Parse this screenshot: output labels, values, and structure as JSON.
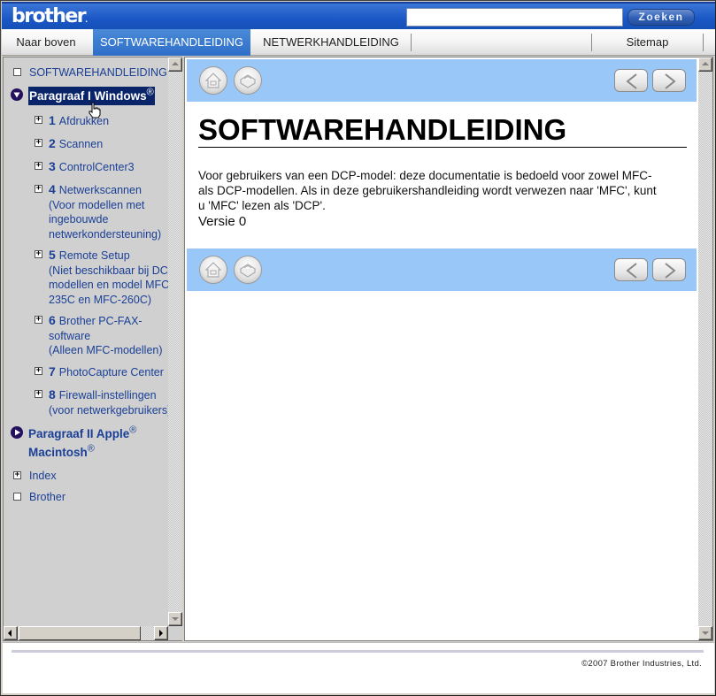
{
  "header": {
    "logo": "brother",
    "search": {
      "value": "",
      "placeholder": ""
    },
    "search_button": "Zoeken"
  },
  "nav": {
    "tabs": [
      {
        "label": "Naar boven",
        "active": false
      },
      {
        "label": "SOFTWAREHANDLEIDING",
        "active": true
      },
      {
        "label": "NETWERKHANDLEIDING",
        "active": false
      },
      {
        "label": "Sitemap",
        "active": false
      }
    ]
  },
  "sidebar": {
    "root": {
      "label": "SOFTWAREHANDLEIDING",
      "icon": "page-icon"
    },
    "section1": {
      "label": "Paragraaf I Windows",
      "sup": "®",
      "state": "expanded",
      "selected": true
    },
    "items": [
      {
        "num": "1",
        "lines": [
          "Afdrukken"
        ]
      },
      {
        "num": "2",
        "lines": [
          "Scannen"
        ]
      },
      {
        "num": "3",
        "lines": [
          "ControlCenter3"
        ]
      },
      {
        "num": "4",
        "lines": [
          "Netwerkscannen",
          "(Voor modellen met",
          "ingebouwde",
          "netwerkondersteuning)"
        ]
      },
      {
        "num": "5",
        "lines": [
          "Remote Setup",
          "(Niet beschikbaar bij DCP-",
          "modellen en model MFC-",
          "235C en MFC-260C)"
        ]
      },
      {
        "num": "6",
        "lines": [
          "Brother PC-FAX-",
          "software",
          "(Alleen MFC-modellen)"
        ]
      },
      {
        "num": "7",
        "lines": [
          "PhotoCapture Center"
        ]
      },
      {
        "num": "8",
        "lines": [
          "Firewall-instellingen",
          "(voor netwerkgebruikers)"
        ]
      }
    ],
    "section2": {
      "line1": "Paragraaf II Apple",
      "line2": "Macintosh",
      "sup": "®",
      "state": "collapsed"
    },
    "index": {
      "label": "Index",
      "icon": "plus-icon"
    },
    "brother": {
      "label": "Brother",
      "icon": "page-icon"
    }
  },
  "main": {
    "title": "SOFTWAREHANDLEIDING",
    "intro": "Voor gebruikers van een DCP-model: deze documentatie is bedoeld voor zowel MFC-als DCP-modellen. Als in deze gebruikershandleiding wordt verwezen naar 'MFC', kunt u 'MFC' lezen als 'DCP'.",
    "intro_lines": [
      "Voor gebruikers van een DCP-model: deze documentatie is bedoeld voor zowel MFC-",
      "als DCP-modellen. Als in deze gebruikershandleiding wordt verwezen naar 'MFC', kunt",
      "u 'MFC' lezen als 'DCP'."
    ],
    "version": "Versie 0",
    "toolbar_icons": [
      "home-icon",
      "index-box-icon",
      "previous-arrow-icon",
      "next-arrow-icon"
    ]
  },
  "footer": {
    "copyright": "©2007 Brother Industries, Ltd."
  }
}
